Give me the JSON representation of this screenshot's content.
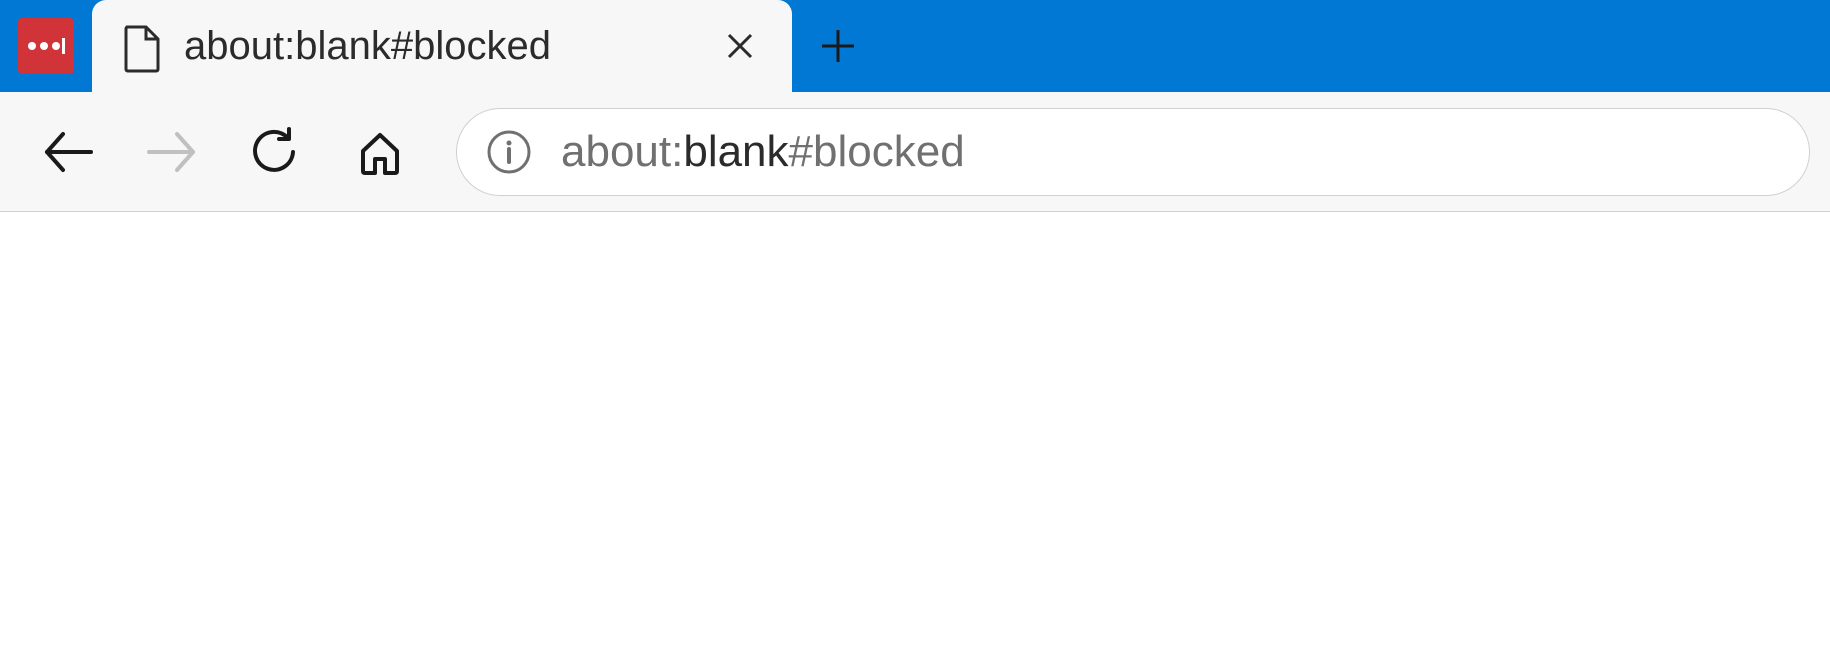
{
  "tabStrip": {
    "pinnedIconName": "lastpass-icon",
    "tab": {
      "title": "about:blank#blocked"
    }
  },
  "addressBar": {
    "url_prefix": "about:",
    "url_highlight": "blank",
    "url_suffix": "#blocked"
  }
}
